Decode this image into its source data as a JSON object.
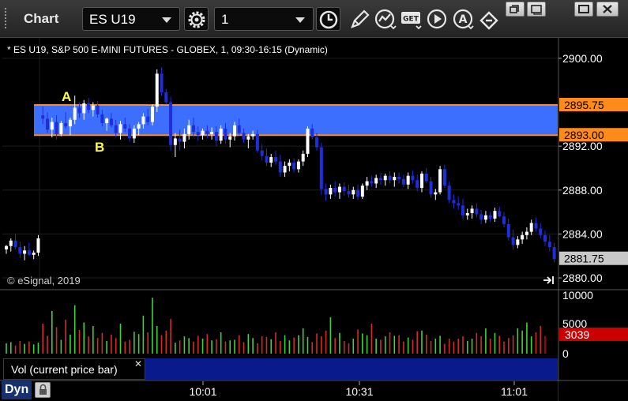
{
  "window": {
    "title": "Chart",
    "symbol": "ES U19",
    "interval": "1"
  },
  "toolbar_icons": [
    "settings-gear-icon",
    "clock-icon",
    "pencil-icon",
    "study-icon",
    "get-icon",
    "play-icon",
    "alert-icon",
    "link-icon"
  ],
  "window_controls": [
    "restore-icon",
    "pop-out-icon",
    "maximize-icon",
    "close-icon"
  ],
  "chart": {
    "header": "* ES U19, S&P 500 E-MINI FUTURES - GLOBEX, 1, 09:30-16:15 (Dynamic)",
    "copyright": "© eSignal, 2019",
    "price_labels": [
      "2900.00",
      "2892.00",
      "2888.00",
      "2884.00",
      "2880.00"
    ],
    "price_ticks": [
      2900,
      2892,
      2888,
      2884,
      2880
    ],
    "time_labels": [
      "10:01",
      "10:31",
      "11:01"
    ],
    "zone": {
      "upper": "2895.75",
      "lower": "2893.00",
      "upper_value": 2895.75,
      "lower_value": 2893.0,
      "color": "#3d6fff",
      "line_color": "#ff8c1a"
    },
    "current_price": "2881.75",
    "current_price_value": 2881.75,
    "markers": [
      {
        "label": "A",
        "color": "#ffff33"
      },
      {
        "label": "B",
        "color": "#ffff33"
      }
    ],
    "colors": {
      "up": "#ffffff",
      "down": "#1f2ddb",
      "volume_up": "#3fd13f",
      "volume_down": "#d42a2a",
      "volume_current": "#cc0000"
    }
  },
  "volume": {
    "panel_label": "Vol (current price bar)",
    "axis_labels": [
      "10000",
      "5000",
      "0"
    ],
    "current_value": "3039"
  },
  "footer": {
    "mode": "Dyn"
  },
  "chart_data": {
    "type": "candlestick",
    "title": "* ES U19, S&P 500 E-MINI FUTURES - GLOBEX, 1, 09:30-16:15 (Dynamic)",
    "y_range": [
      2879.5,
      2901.5
    ],
    "x_labels": [
      "10:01",
      "10:31",
      "11:01"
    ],
    "bars": [
      {
        "o": 2882.6,
        "h": 2883.0,
        "l": 2882.2,
        "c": 2882.9
      },
      {
        "o": 2882.9,
        "h": 2883.6,
        "l": 2882.4,
        "c": 2883.4
      },
      {
        "o": 2883.4,
        "h": 2884.0,
        "l": 2882.6,
        "c": 2882.8
      },
      {
        "o": 2882.8,
        "h": 2883.3,
        "l": 2881.8,
        "c": 2882.2
      },
      {
        "o": 2882.2,
        "h": 2882.9,
        "l": 2881.6,
        "c": 2882.5
      },
      {
        "o": 2882.5,
        "h": 2883.2,
        "l": 2882.0,
        "c": 2882.1
      },
      {
        "o": 2882.1,
        "h": 2882.5,
        "l": 2881.7,
        "c": 2882.3
      },
      {
        "o": 2882.3,
        "h": 2883.9,
        "l": 2882.0,
        "c": 2883.6
      },
      {
        "o": 2894.8,
        "h": 2895.6,
        "l": 2894.0,
        "c": 2894.5
      },
      {
        "o": 2894.5,
        "h": 2895.1,
        "l": 2893.2,
        "c": 2893.5
      },
      {
        "o": 2893.5,
        "h": 2894.6,
        "l": 2892.8,
        "c": 2894.2
      },
      {
        "o": 2894.2,
        "h": 2894.8,
        "l": 2892.6,
        "c": 2893.1
      },
      {
        "o": 2893.1,
        "h": 2894.3,
        "l": 2892.9,
        "c": 2894.1
      },
      {
        "o": 2894.1,
        "h": 2895.1,
        "l": 2893.6,
        "c": 2893.8
      },
      {
        "o": 2893.8,
        "h": 2894.6,
        "l": 2893.0,
        "c": 2894.4
      },
      {
        "o": 2894.4,
        "h": 2896.6,
        "l": 2894.0,
        "c": 2895.5
      },
      {
        "o": 2895.5,
        "h": 2896.0,
        "l": 2894.6,
        "c": 2895.0
      },
      {
        "o": 2895.0,
        "h": 2896.2,
        "l": 2894.4,
        "c": 2895.9
      },
      {
        "o": 2895.9,
        "h": 2896.4,
        "l": 2895.0,
        "c": 2895.3
      },
      {
        "o": 2895.3,
        "h": 2896.0,
        "l": 2894.7,
        "c": 2895.7
      },
      {
        "o": 2895.7,
        "h": 2896.1,
        "l": 2894.6,
        "c": 2894.9
      },
      {
        "o": 2894.9,
        "h": 2895.3,
        "l": 2893.8,
        "c": 2894.1
      },
      {
        "o": 2894.1,
        "h": 2894.6,
        "l": 2893.4,
        "c": 2894.5
      },
      {
        "o": 2894.5,
        "h": 2895.0,
        "l": 2893.7,
        "c": 2893.9
      },
      {
        "o": 2893.9,
        "h": 2894.4,
        "l": 2892.8,
        "c": 2893.2
      },
      {
        "o": 2893.2,
        "h": 2894.3,
        "l": 2892.6,
        "c": 2894.0
      },
      {
        "o": 2894.0,
        "h": 2894.6,
        "l": 2893.3,
        "c": 2893.6
      },
      {
        "o": 2893.6,
        "h": 2894.0,
        "l": 2892.4,
        "c": 2892.7
      },
      {
        "o": 2892.7,
        "h": 2893.9,
        "l": 2892.3,
        "c": 2893.6
      },
      {
        "o": 2893.6,
        "h": 2894.2,
        "l": 2893.0,
        "c": 2894.0
      },
      {
        "o": 2894.0,
        "h": 2895.0,
        "l": 2893.6,
        "c": 2894.7
      },
      {
        "o": 2894.7,
        "h": 2895.4,
        "l": 2893.9,
        "c": 2894.2
      },
      {
        "o": 2894.2,
        "h": 2895.8,
        "l": 2893.9,
        "c": 2895.6
      },
      {
        "o": 2895.6,
        "h": 2899.0,
        "l": 2895.1,
        "c": 2898.6
      },
      {
        "o": 2898.6,
        "h": 2899.2,
        "l": 2896.6,
        "c": 2896.9
      },
      {
        "o": 2896.9,
        "h": 2897.2,
        "l": 2895.8,
        "c": 2896.0
      },
      {
        "o": 2896.0,
        "h": 2896.5,
        "l": 2891.6,
        "c": 2892.1
      },
      {
        "o": 2892.1,
        "h": 2893.2,
        "l": 2891.0,
        "c": 2892.7
      },
      {
        "o": 2892.7,
        "h": 2893.5,
        "l": 2891.6,
        "c": 2892.4
      },
      {
        "o": 2892.4,
        "h": 2893.6,
        "l": 2891.8,
        "c": 2893.1
      },
      {
        "o": 2893.1,
        "h": 2894.4,
        "l": 2892.6,
        "c": 2893.9
      },
      {
        "o": 2893.9,
        "h": 2894.6,
        "l": 2892.8,
        "c": 2893.3
      },
      {
        "o": 2893.3,
        "h": 2893.8,
        "l": 2892.5,
        "c": 2893.0
      },
      {
        "o": 2893.0,
        "h": 2893.6,
        "l": 2892.6,
        "c": 2893.4
      },
      {
        "o": 2893.4,
        "h": 2893.9,
        "l": 2892.7,
        "c": 2893.1
      },
      {
        "o": 2893.1,
        "h": 2893.7,
        "l": 2892.6,
        "c": 2893.3
      },
      {
        "o": 2893.3,
        "h": 2893.8,
        "l": 2892.0,
        "c": 2892.5
      },
      {
        "o": 2892.5,
        "h": 2893.9,
        "l": 2892.2,
        "c": 2893.6
      },
      {
        "o": 2893.6,
        "h": 2894.1,
        "l": 2892.2,
        "c": 2892.6
      },
      {
        "o": 2892.6,
        "h": 2893.2,
        "l": 2891.9,
        "c": 2892.9
      },
      {
        "o": 2892.9,
        "h": 2894.2,
        "l": 2892.5,
        "c": 2893.9
      },
      {
        "o": 2893.9,
        "h": 2894.5,
        "l": 2893.0,
        "c": 2893.2
      },
      {
        "o": 2893.2,
        "h": 2893.6,
        "l": 2892.3,
        "c": 2892.6
      },
      {
        "o": 2892.6,
        "h": 2893.1,
        "l": 2891.8,
        "c": 2892.9
      },
      {
        "o": 2892.9,
        "h": 2893.4,
        "l": 2892.6,
        "c": 2893.1
      },
      {
        "o": 2893.1,
        "h": 2893.5,
        "l": 2891.4,
        "c": 2891.6
      },
      {
        "o": 2891.6,
        "h": 2892.2,
        "l": 2890.7,
        "c": 2891.1
      },
      {
        "o": 2891.1,
        "h": 2891.8,
        "l": 2890.2,
        "c": 2890.5
      },
      {
        "o": 2890.5,
        "h": 2891.3,
        "l": 2890.1,
        "c": 2891.0
      },
      {
        "o": 2891.0,
        "h": 2891.6,
        "l": 2890.3,
        "c": 2890.6
      },
      {
        "o": 2890.6,
        "h": 2891.2,
        "l": 2889.2,
        "c": 2889.6
      },
      {
        "o": 2889.6,
        "h": 2890.6,
        "l": 2889.2,
        "c": 2890.2
      },
      {
        "o": 2890.2,
        "h": 2890.8,
        "l": 2889.7,
        "c": 2890.5
      },
      {
        "o": 2890.5,
        "h": 2890.9,
        "l": 2889.6,
        "c": 2889.9
      },
      {
        "o": 2889.9,
        "h": 2890.8,
        "l": 2889.6,
        "c": 2890.6
      },
      {
        "o": 2890.6,
        "h": 2891.6,
        "l": 2890.2,
        "c": 2891.3
      },
      {
        "o": 2891.3,
        "h": 2893.8,
        "l": 2891.0,
        "c": 2893.6
      },
      {
        "o": 2893.6,
        "h": 2894.0,
        "l": 2892.6,
        "c": 2892.8
      },
      {
        "o": 2892.8,
        "h": 2893.2,
        "l": 2891.6,
        "c": 2891.9
      },
      {
        "o": 2891.9,
        "h": 2892.3,
        "l": 2887.6,
        "c": 2888.1
      },
      {
        "o": 2888.1,
        "h": 2888.6,
        "l": 2887.0,
        "c": 2887.6
      },
      {
        "o": 2887.6,
        "h": 2888.5,
        "l": 2887.2,
        "c": 2888.2
      },
      {
        "o": 2888.2,
        "h": 2888.8,
        "l": 2887.4,
        "c": 2887.8
      },
      {
        "o": 2887.8,
        "h": 2888.6,
        "l": 2887.2,
        "c": 2888.3
      },
      {
        "o": 2888.3,
        "h": 2888.7,
        "l": 2887.5,
        "c": 2887.9
      },
      {
        "o": 2887.9,
        "h": 2888.5,
        "l": 2887.3,
        "c": 2887.6
      },
      {
        "o": 2887.6,
        "h": 2888.3,
        "l": 2887.2,
        "c": 2888.0
      },
      {
        "o": 2888.0,
        "h": 2888.5,
        "l": 2887.1,
        "c": 2887.4
      },
      {
        "o": 2887.4,
        "h": 2888.6,
        "l": 2887.2,
        "c": 2888.4
      },
      {
        "o": 2888.4,
        "h": 2889.2,
        "l": 2888.0,
        "c": 2888.8
      },
      {
        "o": 2888.8,
        "h": 2889.3,
        "l": 2888.3,
        "c": 2888.6
      },
      {
        "o": 2888.6,
        "h": 2889.4,
        "l": 2888.2,
        "c": 2889.1
      },
      {
        "o": 2889.1,
        "h": 2889.6,
        "l": 2888.5,
        "c": 2888.9
      },
      {
        "o": 2888.9,
        "h": 2889.5,
        "l": 2888.4,
        "c": 2889.3
      },
      {
        "o": 2889.3,
        "h": 2889.7,
        "l": 2888.6,
        "c": 2888.9
      },
      {
        "o": 2888.9,
        "h": 2889.6,
        "l": 2888.3,
        "c": 2889.2
      },
      {
        "o": 2889.2,
        "h": 2889.6,
        "l": 2888.6,
        "c": 2889.0
      },
      {
        "o": 2889.0,
        "h": 2889.4,
        "l": 2888.3,
        "c": 2888.5
      },
      {
        "o": 2888.5,
        "h": 2889.6,
        "l": 2888.1,
        "c": 2889.3
      },
      {
        "o": 2889.3,
        "h": 2889.8,
        "l": 2888.6,
        "c": 2888.9
      },
      {
        "o": 2888.9,
        "h": 2889.4,
        "l": 2887.9,
        "c": 2888.2
      },
      {
        "o": 2888.2,
        "h": 2889.7,
        "l": 2887.8,
        "c": 2889.5
      },
      {
        "o": 2889.5,
        "h": 2890.0,
        "l": 2888.6,
        "c": 2888.8
      },
      {
        "o": 2888.8,
        "h": 2889.2,
        "l": 2887.3,
        "c": 2887.6
      },
      {
        "o": 2887.6,
        "h": 2888.1,
        "l": 2887.1,
        "c": 2887.8
      },
      {
        "o": 2887.8,
        "h": 2890.2,
        "l": 2887.6,
        "c": 2889.9
      },
      {
        "o": 2889.9,
        "h": 2890.3,
        "l": 2888.2,
        "c": 2888.4
      },
      {
        "o": 2888.4,
        "h": 2888.8,
        "l": 2886.8,
        "c": 2887.1
      },
      {
        "o": 2887.1,
        "h": 2887.6,
        "l": 2886.3,
        "c": 2886.8
      },
      {
        "o": 2886.8,
        "h": 2887.4,
        "l": 2886.2,
        "c": 2886.6
      },
      {
        "o": 2886.6,
        "h": 2887.2,
        "l": 2885.3,
        "c": 2885.7
      },
      {
        "o": 2885.7,
        "h": 2886.3,
        "l": 2885.3,
        "c": 2885.9
      },
      {
        "o": 2885.9,
        "h": 2886.6,
        "l": 2885.4,
        "c": 2886.3
      },
      {
        "o": 2886.3,
        "h": 2886.8,
        "l": 2885.5,
        "c": 2885.8
      },
      {
        "o": 2885.8,
        "h": 2886.2,
        "l": 2884.9,
        "c": 2885.3
      },
      {
        "o": 2885.3,
        "h": 2886.1,
        "l": 2885.0,
        "c": 2885.7
      },
      {
        "o": 2885.7,
        "h": 2886.0,
        "l": 2885.1,
        "c": 2885.4
      },
      {
        "o": 2885.4,
        "h": 2886.4,
        "l": 2885.1,
        "c": 2886.1
      },
      {
        "o": 2886.1,
        "h": 2886.5,
        "l": 2885.5,
        "c": 2885.6
      },
      {
        "o": 2885.6,
        "h": 2886.0,
        "l": 2884.6,
        "c": 2884.9
      },
      {
        "o": 2884.9,
        "h": 2885.4,
        "l": 2883.4,
        "c": 2883.7
      },
      {
        "o": 2883.7,
        "h": 2884.4,
        "l": 2882.6,
        "c": 2883.0
      },
      {
        "o": 2883.0,
        "h": 2883.8,
        "l": 2882.7,
        "c": 2883.5
      },
      {
        "o": 2883.5,
        "h": 2884.2,
        "l": 2883.1,
        "c": 2883.9
      },
      {
        "o": 2883.9,
        "h": 2884.6,
        "l": 2883.5,
        "c": 2884.2
      },
      {
        "o": 2884.2,
        "h": 2885.3,
        "l": 2883.9,
        "c": 2885.0
      },
      {
        "o": 2885.0,
        "h": 2885.5,
        "l": 2884.2,
        "c": 2884.5
      },
      {
        "o": 2884.5,
        "h": 2885.0,
        "l": 2883.6,
        "c": 2883.9
      },
      {
        "o": 2883.9,
        "h": 2884.3,
        "l": 2882.9,
        "c": 2883.3
      },
      {
        "o": 2883.3,
        "h": 2883.9,
        "l": 2882.4,
        "c": 2882.8
      },
      {
        "o": 2882.8,
        "h": 2883.2,
        "l": 2881.4,
        "c": 2881.7
      }
    ],
    "volume": [
      1800,
      2000,
      1400,
      2200,
      1700,
      2100,
      1600,
      1900,
      5200,
      3100,
      7400,
      4600,
      2400,
      5900,
      3300,
      8400,
      4100,
      5400,
      3000,
      4800,
      2700,
      3600,
      2200,
      3300,
      2700,
      5200,
      2100,
      2400,
      3800,
      3400,
      6600,
      3700,
      9700,
      4800,
      3200,
      4000,
      6000,
      1900,
      2300,
      3000,
      2700,
      2100,
      3100,
      2600,
      3400,
      2300,
      2500,
      3700,
      2100,
      2300,
      2400,
      3200,
      2000,
      3400,
      2700,
      1800,
      3000,
      2900,
      2500,
      3700,
      2200,
      3200,
      2300,
      2800,
      3200,
      4400,
      2900,
      2000,
      3500,
      3000,
      4000,
      6300,
      2700,
      3600,
      2200,
      1800,
      2600,
      4200,
      3500,
      3200,
      5200,
      2600,
      2400,
      3000,
      3700,
      3100,
      3200,
      2100,
      2800,
      2400,
      3900,
      4000,
      3300,
      2200,
      2600,
      3100,
      1700,
      2600,
      2100,
      2600,
      3000,
      2200,
      2600,
      3600,
      3000,
      4400,
      2600,
      3600,
      3100,
      2100,
      2700,
      3200,
      4400,
      4000,
      5400,
      3000,
      3700,
      4800,
      3039
    ]
  }
}
